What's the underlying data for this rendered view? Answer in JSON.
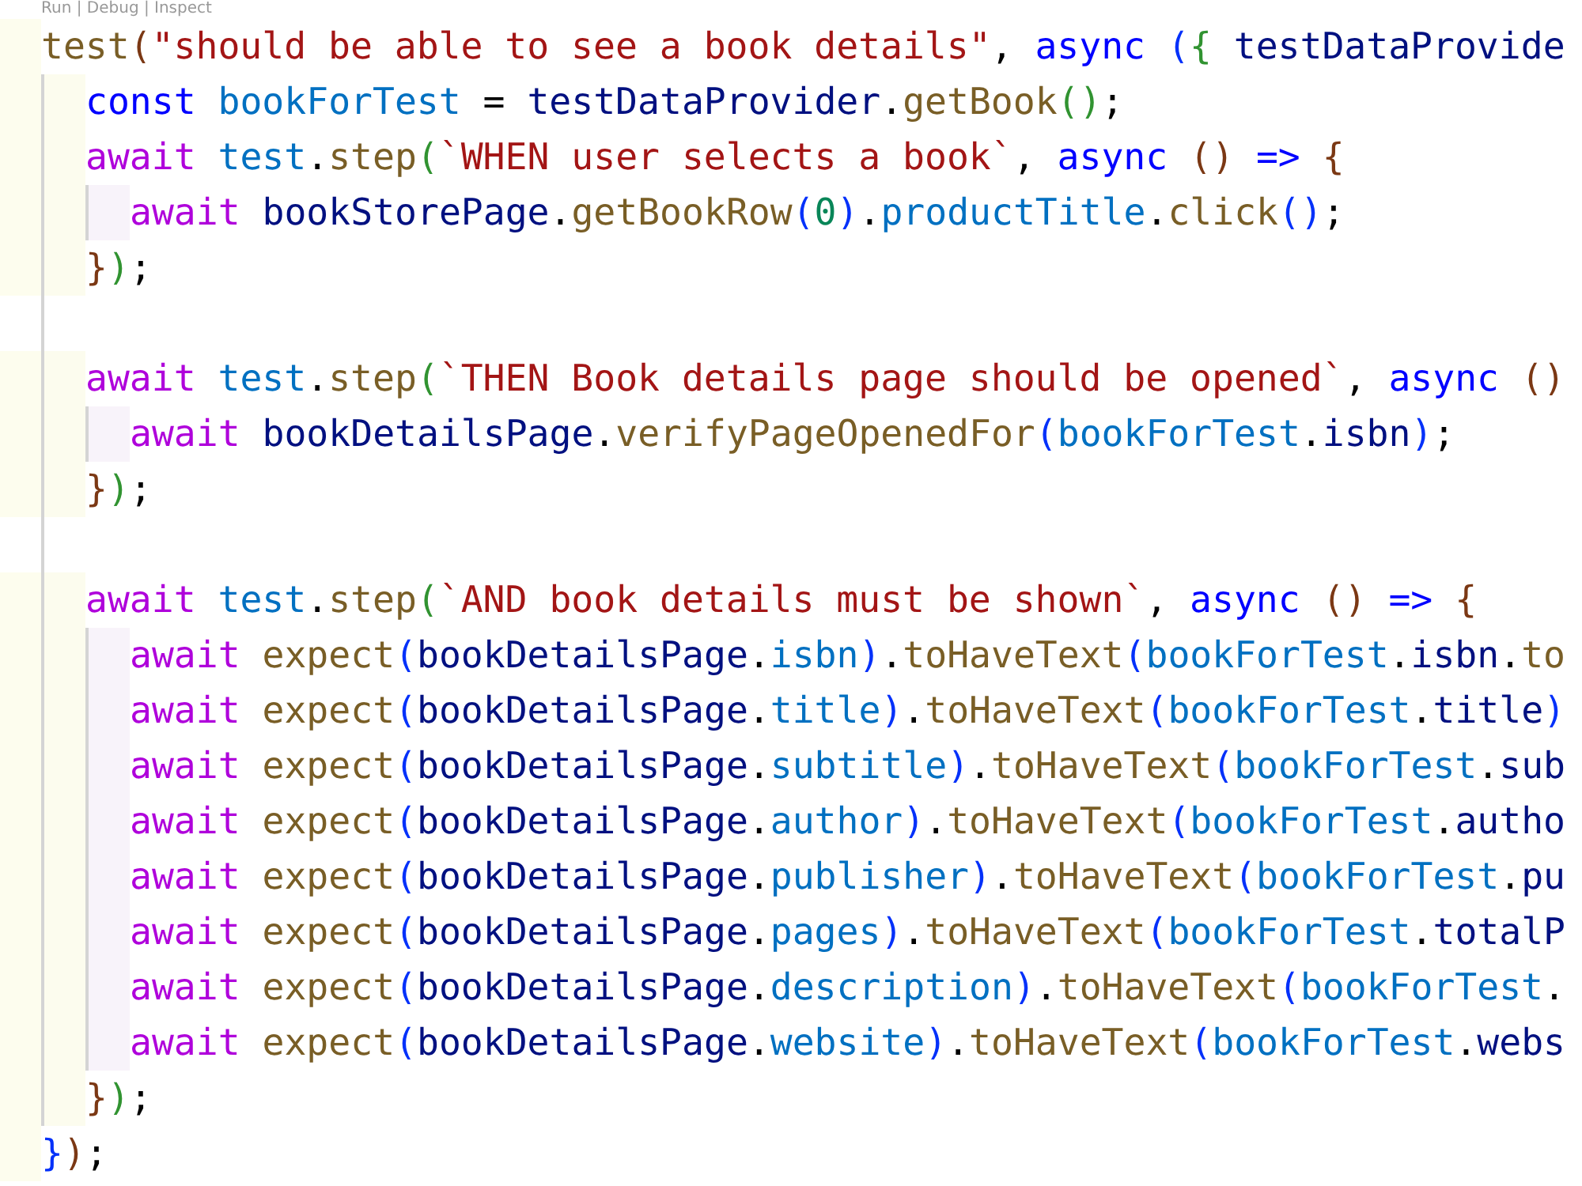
{
  "code_lens": "Run | Debug | Inspect",
  "lines": [
    {
      "kind": "code",
      "tokens": [
        {
          "kind": "function",
          "text": "test"
        },
        {
          "kind": "bracket-a",
          "text": "("
        },
        {
          "kind": "string",
          "text": "\"should be able to see a book details\""
        },
        {
          "kind": "plain",
          "text": ", "
        },
        {
          "kind": "keyword",
          "text": "async "
        },
        {
          "kind": "bracket-b",
          "text": "("
        },
        {
          "kind": "bracket-c",
          "text": "{ "
        },
        {
          "kind": "variable",
          "text": "testDataProvide"
        }
      ],
      "children": [
        {
          "kind": "code",
          "tokens": [
            {
              "kind": "keyword",
              "text": "const "
            },
            {
              "kind": "constant",
              "text": "bookForTest"
            },
            {
              "kind": "plain",
              "text": " = "
            },
            {
              "kind": "variable",
              "text": "testDataProvider"
            },
            {
              "kind": "plain",
              "text": "."
            },
            {
              "kind": "function",
              "text": "getBook"
            },
            {
              "kind": "bracket-c",
              "text": "()"
            },
            {
              "kind": "plain",
              "text": ";"
            }
          ]
        },
        {
          "kind": "code",
          "tokens": [
            {
              "kind": "control",
              "text": "await "
            },
            {
              "kind": "constant",
              "text": "test"
            },
            {
              "kind": "plain",
              "text": "."
            },
            {
              "kind": "function",
              "text": "step"
            },
            {
              "kind": "bracket-c",
              "text": "("
            },
            {
              "kind": "string",
              "text": "`WHEN user selects a book`"
            },
            {
              "kind": "plain",
              "text": ", "
            },
            {
              "kind": "keyword",
              "text": "async "
            },
            {
              "kind": "bracket-a",
              "text": "() "
            },
            {
              "kind": "keyword",
              "text": "=> "
            },
            {
              "kind": "bracket-a",
              "text": "{"
            }
          ],
          "children": [
            {
              "kind": "code",
              "tokens": [
                {
                  "kind": "control",
                  "text": "await "
                },
                {
                  "kind": "variable",
                  "text": "bookStorePage"
                },
                {
                  "kind": "plain",
                  "text": "."
                },
                {
                  "kind": "function",
                  "text": "getBookRow"
                },
                {
                  "kind": "bracket-b",
                  "text": "("
                },
                {
                  "kind": "number",
                  "text": "0"
                },
                {
                  "kind": "bracket-b",
                  "text": ")"
                },
                {
                  "kind": "plain",
                  "text": "."
                },
                {
                  "kind": "constant",
                  "text": "productTitle"
                },
                {
                  "kind": "plain",
                  "text": "."
                },
                {
                  "kind": "function",
                  "text": "click"
                },
                {
                  "kind": "bracket-b",
                  "text": "()"
                },
                {
                  "kind": "plain",
                  "text": ";"
                }
              ]
            }
          ]
        },
        {
          "kind": "code",
          "tokens": [
            {
              "kind": "bracket-a",
              "text": "}"
            },
            {
              "kind": "bracket-c",
              "text": ")"
            },
            {
              "kind": "plain",
              "text": ";"
            }
          ]
        },
        {
          "kind": "blank"
        },
        {
          "kind": "code",
          "tokens": [
            {
              "kind": "control",
              "text": "await "
            },
            {
              "kind": "constant",
              "text": "test"
            },
            {
              "kind": "plain",
              "text": "."
            },
            {
              "kind": "function",
              "text": "step"
            },
            {
              "kind": "bracket-c",
              "text": "("
            },
            {
              "kind": "string",
              "text": "`THEN Book details page should be opened`"
            },
            {
              "kind": "plain",
              "text": ", "
            },
            {
              "kind": "keyword",
              "text": "async "
            },
            {
              "kind": "bracket-a",
              "text": "()"
            }
          ],
          "children": [
            {
              "kind": "code",
              "tokens": [
                {
                  "kind": "control",
                  "text": "await "
                },
                {
                  "kind": "variable",
                  "text": "bookDetailsPage"
                },
                {
                  "kind": "plain",
                  "text": "."
                },
                {
                  "kind": "function",
                  "text": "verifyPageOpenedFor"
                },
                {
                  "kind": "bracket-b",
                  "text": "("
                },
                {
                  "kind": "constant",
                  "text": "bookForTest"
                },
                {
                  "kind": "plain",
                  "text": "."
                },
                {
                  "kind": "variable",
                  "text": "isbn"
                },
                {
                  "kind": "bracket-b",
                  "text": ")"
                },
                {
                  "kind": "plain",
                  "text": ";"
                }
              ]
            }
          ]
        },
        {
          "kind": "code",
          "tokens": [
            {
              "kind": "bracket-a",
              "text": "}"
            },
            {
              "kind": "bracket-c",
              "text": ")"
            },
            {
              "kind": "plain",
              "text": ";"
            }
          ]
        },
        {
          "kind": "blank"
        },
        {
          "kind": "code",
          "tokens": [
            {
              "kind": "control",
              "text": "await "
            },
            {
              "kind": "constant",
              "text": "test"
            },
            {
              "kind": "plain",
              "text": "."
            },
            {
              "kind": "function",
              "text": "step"
            },
            {
              "kind": "bracket-c",
              "text": "("
            },
            {
              "kind": "string",
              "text": "`AND book details must be shown`"
            },
            {
              "kind": "plain",
              "text": ", "
            },
            {
              "kind": "keyword",
              "text": "async "
            },
            {
              "kind": "bracket-a",
              "text": "() "
            },
            {
              "kind": "keyword",
              "text": "=> "
            },
            {
              "kind": "bracket-a",
              "text": "{"
            }
          ],
          "children": [
            {
              "kind": "code",
              "tokens": [
                {
                  "kind": "control",
                  "text": "await "
                },
                {
                  "kind": "function",
                  "text": "expect"
                },
                {
                  "kind": "bracket-b",
                  "text": "("
                },
                {
                  "kind": "variable",
                  "text": "bookDetailsPage"
                },
                {
                  "kind": "plain",
                  "text": "."
                },
                {
                  "kind": "constant",
                  "text": "isbn"
                },
                {
                  "kind": "bracket-b",
                  "text": ")"
                },
                {
                  "kind": "plain",
                  "text": "."
                },
                {
                  "kind": "function",
                  "text": "toHaveText"
                },
                {
                  "kind": "bracket-b",
                  "text": "("
                },
                {
                  "kind": "constant",
                  "text": "bookForTest"
                },
                {
                  "kind": "plain",
                  "text": "."
                },
                {
                  "kind": "variable",
                  "text": "isbn"
                },
                {
                  "kind": "plain",
                  "text": "."
                },
                {
                  "kind": "function",
                  "text": "to"
                }
              ]
            },
            {
              "kind": "code",
              "tokens": [
                {
                  "kind": "control",
                  "text": "await "
                },
                {
                  "kind": "function",
                  "text": "expect"
                },
                {
                  "kind": "bracket-b",
                  "text": "("
                },
                {
                  "kind": "variable",
                  "text": "bookDetailsPage"
                },
                {
                  "kind": "plain",
                  "text": "."
                },
                {
                  "kind": "constant",
                  "text": "title"
                },
                {
                  "kind": "bracket-b",
                  "text": ")"
                },
                {
                  "kind": "plain",
                  "text": "."
                },
                {
                  "kind": "function",
                  "text": "toHaveText"
                },
                {
                  "kind": "bracket-b",
                  "text": "("
                },
                {
                  "kind": "constant",
                  "text": "bookForTest"
                },
                {
                  "kind": "plain",
                  "text": "."
                },
                {
                  "kind": "variable",
                  "text": "title"
                },
                {
                  "kind": "bracket-b",
                  "text": ")"
                }
              ]
            },
            {
              "kind": "code",
              "tokens": [
                {
                  "kind": "control",
                  "text": "await "
                },
                {
                  "kind": "function",
                  "text": "expect"
                },
                {
                  "kind": "bracket-b",
                  "text": "("
                },
                {
                  "kind": "variable",
                  "text": "bookDetailsPage"
                },
                {
                  "kind": "plain",
                  "text": "."
                },
                {
                  "kind": "constant",
                  "text": "subtitle"
                },
                {
                  "kind": "bracket-b",
                  "text": ")"
                },
                {
                  "kind": "plain",
                  "text": "."
                },
                {
                  "kind": "function",
                  "text": "toHaveText"
                },
                {
                  "kind": "bracket-b",
                  "text": "("
                },
                {
                  "kind": "constant",
                  "text": "bookForTest"
                },
                {
                  "kind": "plain",
                  "text": "."
                },
                {
                  "kind": "variable",
                  "text": "sub"
                }
              ]
            },
            {
              "kind": "code",
              "tokens": [
                {
                  "kind": "control",
                  "text": "await "
                },
                {
                  "kind": "function",
                  "text": "expect"
                },
                {
                  "kind": "bracket-b",
                  "text": "("
                },
                {
                  "kind": "variable",
                  "text": "bookDetailsPage"
                },
                {
                  "kind": "plain",
                  "text": "."
                },
                {
                  "kind": "constant",
                  "text": "author"
                },
                {
                  "kind": "bracket-b",
                  "text": ")"
                },
                {
                  "kind": "plain",
                  "text": "."
                },
                {
                  "kind": "function",
                  "text": "toHaveText"
                },
                {
                  "kind": "bracket-b",
                  "text": "("
                },
                {
                  "kind": "constant",
                  "text": "bookForTest"
                },
                {
                  "kind": "plain",
                  "text": "."
                },
                {
                  "kind": "variable",
                  "text": "autho"
                }
              ]
            },
            {
              "kind": "code",
              "tokens": [
                {
                  "kind": "control",
                  "text": "await "
                },
                {
                  "kind": "function",
                  "text": "expect"
                },
                {
                  "kind": "bracket-b",
                  "text": "("
                },
                {
                  "kind": "variable",
                  "text": "bookDetailsPage"
                },
                {
                  "kind": "plain",
                  "text": "."
                },
                {
                  "kind": "constant",
                  "text": "publisher"
                },
                {
                  "kind": "bracket-b",
                  "text": ")"
                },
                {
                  "kind": "plain",
                  "text": "."
                },
                {
                  "kind": "function",
                  "text": "toHaveText"
                },
                {
                  "kind": "bracket-b",
                  "text": "("
                },
                {
                  "kind": "constant",
                  "text": "bookForTest"
                },
                {
                  "kind": "plain",
                  "text": "."
                },
                {
                  "kind": "variable",
                  "text": "pu"
                }
              ]
            },
            {
              "kind": "code",
              "tokens": [
                {
                  "kind": "control",
                  "text": "await "
                },
                {
                  "kind": "function",
                  "text": "expect"
                },
                {
                  "kind": "bracket-b",
                  "text": "("
                },
                {
                  "kind": "variable",
                  "text": "bookDetailsPage"
                },
                {
                  "kind": "plain",
                  "text": "."
                },
                {
                  "kind": "constant",
                  "text": "pages"
                },
                {
                  "kind": "bracket-b",
                  "text": ")"
                },
                {
                  "kind": "plain",
                  "text": "."
                },
                {
                  "kind": "function",
                  "text": "toHaveText"
                },
                {
                  "kind": "bracket-b",
                  "text": "("
                },
                {
                  "kind": "constant",
                  "text": "bookForTest"
                },
                {
                  "kind": "plain",
                  "text": "."
                },
                {
                  "kind": "variable",
                  "text": "totalP"
                }
              ]
            },
            {
              "kind": "code",
              "tokens": [
                {
                  "kind": "control",
                  "text": "await "
                },
                {
                  "kind": "function",
                  "text": "expect"
                },
                {
                  "kind": "bracket-b",
                  "text": "("
                },
                {
                  "kind": "variable",
                  "text": "bookDetailsPage"
                },
                {
                  "kind": "plain",
                  "text": "."
                },
                {
                  "kind": "constant",
                  "text": "description"
                },
                {
                  "kind": "bracket-b",
                  "text": ")"
                },
                {
                  "kind": "plain",
                  "text": "."
                },
                {
                  "kind": "function",
                  "text": "toHaveText"
                },
                {
                  "kind": "bracket-b",
                  "text": "("
                },
                {
                  "kind": "constant",
                  "text": "bookForTest"
                },
                {
                  "kind": "plain",
                  "text": "."
                }
              ]
            },
            {
              "kind": "code",
              "tokens": [
                {
                  "kind": "control",
                  "text": "await "
                },
                {
                  "kind": "function",
                  "text": "expect"
                },
                {
                  "kind": "bracket-b",
                  "text": "("
                },
                {
                  "kind": "variable",
                  "text": "bookDetailsPage"
                },
                {
                  "kind": "plain",
                  "text": "."
                },
                {
                  "kind": "constant",
                  "text": "website"
                },
                {
                  "kind": "bracket-b",
                  "text": ")"
                },
                {
                  "kind": "plain",
                  "text": "."
                },
                {
                  "kind": "function",
                  "text": "toHaveText"
                },
                {
                  "kind": "bracket-b",
                  "text": "("
                },
                {
                  "kind": "constant",
                  "text": "bookForTest"
                },
                {
                  "kind": "plain",
                  "text": "."
                },
                {
                  "kind": "variable",
                  "text": "webs"
                }
              ]
            }
          ]
        },
        {
          "kind": "code",
          "tokens": [
            {
              "kind": "bracket-a",
              "text": "}"
            },
            {
              "kind": "bracket-c",
              "text": ")"
            },
            {
              "kind": "plain",
              "text": ";"
            }
          ]
        }
      ]
    },
    {
      "kind": "code",
      "tokens": [
        {
          "kind": "bracket-b",
          "text": "}"
        },
        {
          "kind": "bracket-a",
          "text": ")"
        },
        {
          "kind": "plain",
          "text": ";"
        }
      ]
    }
  ]
}
